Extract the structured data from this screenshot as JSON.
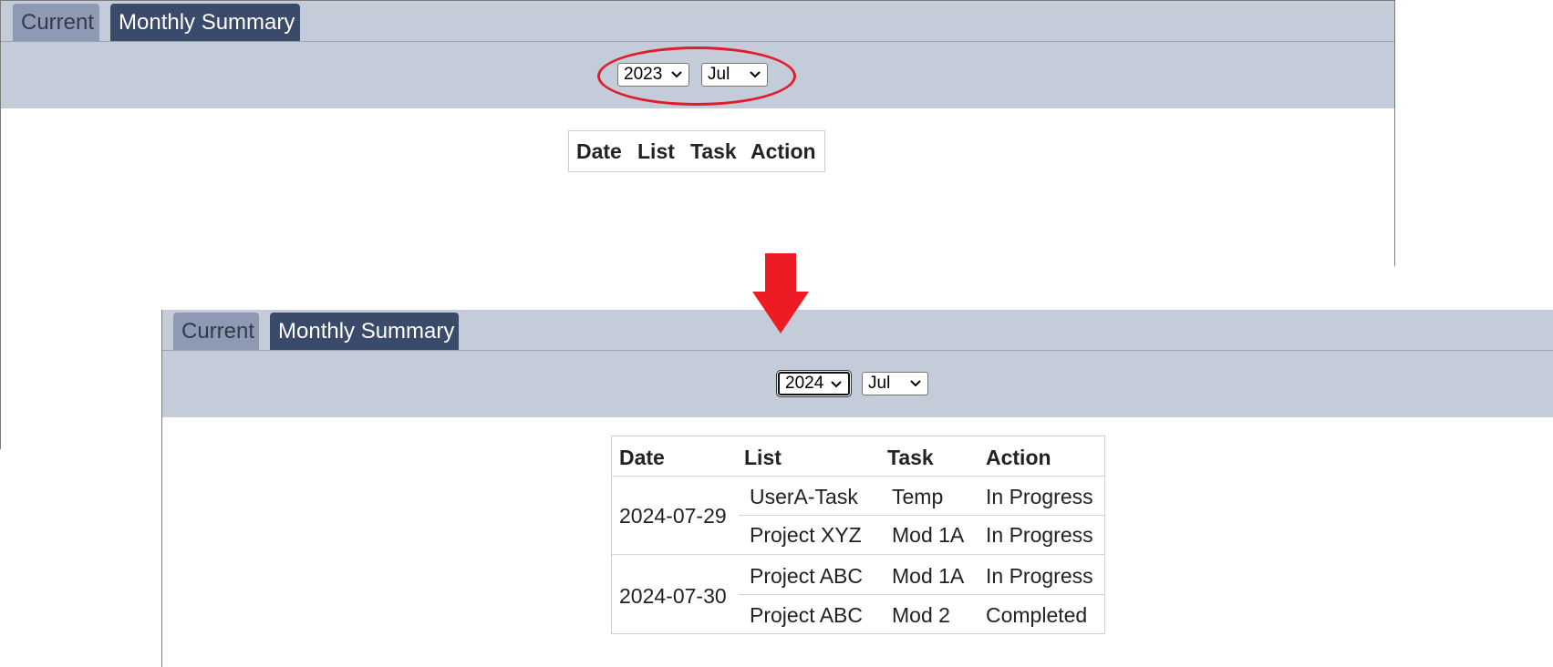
{
  "before": {
    "tabs": [
      {
        "label": "Current",
        "active": false
      },
      {
        "label": "Monthly Summary",
        "active": true
      }
    ],
    "filters": {
      "year": "2023",
      "month": "Jul"
    },
    "table": {
      "headers": [
        "Date",
        "List",
        "Task",
        "Action"
      ],
      "rows": []
    }
  },
  "after": {
    "tabs": [
      {
        "label": "Current",
        "active": false
      },
      {
        "label": "Monthly Summary",
        "active": true
      }
    ],
    "filters": {
      "year": "2024",
      "month": "Jul"
    },
    "table": {
      "headers": [
        "Date",
        "List",
        "Task",
        "Action"
      ],
      "groups": [
        {
          "date": "2024-07-29",
          "rows": [
            {
              "list": "UserA-Task",
              "task": "Temp",
              "action": "In Progress"
            },
            {
              "list": "Project XYZ",
              "task": "Mod 1A",
              "action": "In Progress"
            }
          ]
        },
        {
          "date": "2024-07-30",
          "rows": [
            {
              "list": "Project ABC",
              "task": "Mod 1A",
              "action": "In Progress"
            },
            {
              "list": "Project ABC",
              "task": "Mod 2",
              "action": "Completed"
            }
          ]
        }
      ]
    }
  },
  "annotation_colors": {
    "highlight": "#e01e2b",
    "arrow": "#ed1c24"
  },
  "theme": {
    "bar": "#c5ccd9",
    "tab_active": "#3a4a6b",
    "tab_inactive": "#8e9ab3"
  }
}
